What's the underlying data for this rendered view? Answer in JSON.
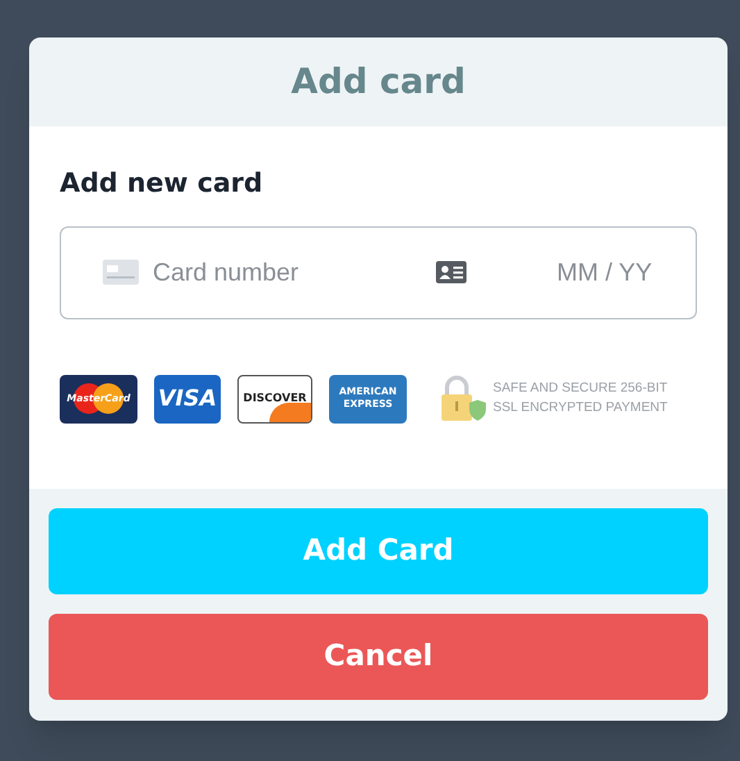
{
  "modal": {
    "title": "Add card"
  },
  "section": {
    "heading": "Add new card"
  },
  "card_field": {
    "number_placeholder": "Card number",
    "expiry_placeholder": "MM / YY"
  },
  "card_brands": [
    {
      "kind": "mastercard",
      "label": "MasterCard"
    },
    {
      "kind": "visa",
      "label": "VISA"
    },
    {
      "kind": "discover",
      "label": "DISCOVER"
    },
    {
      "kind": "amex",
      "label": "AMERICAN EXPRESS"
    }
  ],
  "security_note": [
    "SAFE AND SECURE 256-BIT",
    "SSL ENCRYPTED PAYMENT"
  ],
  "buttons": [
    {
      "kind": "primary",
      "label": "Add Card"
    },
    {
      "kind": "danger",
      "label": "Cancel"
    }
  ]
}
